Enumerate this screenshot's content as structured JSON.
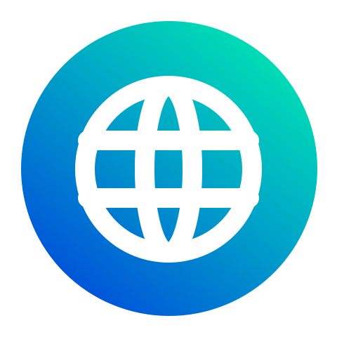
{
  "icon": {
    "name": "globe-icon",
    "colors": {
      "gradient_start": "#0052D9",
      "gradient_mid": "#00A6C7",
      "gradient_end": "#00E3B3",
      "glyph": "#FFFFFF",
      "background": "#FFFFFF"
    }
  }
}
